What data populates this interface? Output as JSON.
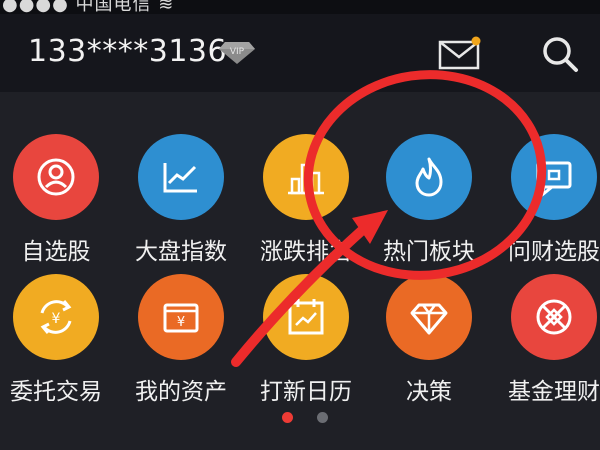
{
  "statusbar": {
    "text": "●●●● 中国电信 ≋"
  },
  "header": {
    "account": "133****3136",
    "vip_badge": "VIP",
    "icons": {
      "mail": "mail-icon",
      "search": "search-icon",
      "vip": "diamond-icon"
    }
  },
  "colors": {
    "red": "#e8463e",
    "blue": "#2e8fd1",
    "yellow": "#f1ab22",
    "orange": "#ea6a25",
    "annotation": "#ec2b2b"
  },
  "grid": {
    "row1": [
      {
        "label": "自选股",
        "icon": "user-circle-icon",
        "color": "#e8463e"
      },
      {
        "label": "大盘指数",
        "icon": "line-chart-icon",
        "color": "#2e8fd1"
      },
      {
        "label": "涨跌排名",
        "icon": "bar-chart-icon",
        "color": "#f1ab22"
      },
      {
        "label": "热门板块",
        "icon": "flame-icon",
        "color": "#2e8fd1"
      },
      {
        "label": "问财选股",
        "icon": "question-chat-icon",
        "color": "#2e8fd1"
      }
    ],
    "row2": [
      {
        "label": "委托交易",
        "icon": "yuan-exchange-icon",
        "color": "#f1ab22"
      },
      {
        "label": "我的资产",
        "icon": "wallet-icon",
        "color": "#ea6a25"
      },
      {
        "label": "打新日历",
        "icon": "calendar-icon",
        "color": "#f1ab22"
      },
      {
        "label": "决策",
        "icon": "diamond-icon",
        "color": "#ea6a25"
      },
      {
        "label": "基金理财",
        "icon": "fund-icon",
        "color": "#e8463e"
      }
    ]
  },
  "pager": {
    "pages": 2,
    "active_page": 1
  }
}
